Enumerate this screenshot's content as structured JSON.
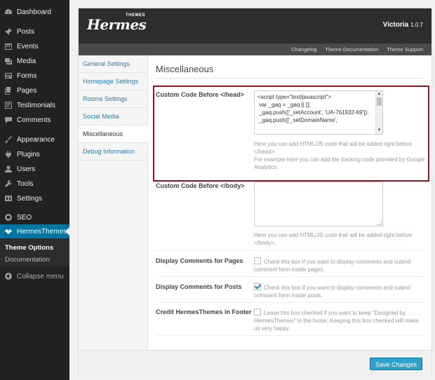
{
  "sidebar": {
    "items": [
      {
        "label": "Dashboard",
        "icon": "dashboard-icon"
      },
      {
        "label": "Posts",
        "icon": "pin-icon"
      },
      {
        "label": "Events",
        "icon": "calendar-icon"
      },
      {
        "label": "Media",
        "icon": "media-icon"
      },
      {
        "label": "Forms",
        "icon": "forms-icon"
      },
      {
        "label": "Pages",
        "icon": "pages-icon"
      },
      {
        "label": "Testimonials",
        "icon": "testimonials-icon"
      },
      {
        "label": "Comments",
        "icon": "comments-icon"
      },
      {
        "label": "Appearance",
        "icon": "brush-icon"
      },
      {
        "label": "Plugins",
        "icon": "plugin-icon"
      },
      {
        "label": "Users",
        "icon": "users-icon"
      },
      {
        "label": "Tools",
        "icon": "wrench-icon"
      },
      {
        "label": "Settings",
        "icon": "settings-icon"
      },
      {
        "label": "SEO",
        "icon": "seo-icon"
      },
      {
        "label": "HermesThemes",
        "icon": "hermes-icon",
        "active": true
      }
    ],
    "submenu": [
      "Theme Options",
      "Documentation"
    ],
    "collapse": "Collapse menu"
  },
  "header": {
    "logo_text": "Hermes",
    "logo_super": "THEMES",
    "theme_name": "Victoria",
    "theme_version": "1.0.7",
    "nav": [
      "Changelog",
      "Theme Documentation",
      "Theme Support"
    ]
  },
  "tabs": [
    {
      "label": "General Settings"
    },
    {
      "label": "Homepage Settings"
    },
    {
      "label": "Rooms Settings"
    },
    {
      "label": "Social Media"
    },
    {
      "label": "Miscellaneous",
      "active": true
    },
    {
      "label": "Debug Information"
    }
  ],
  "section": {
    "title": "Miscellaneous",
    "head_label": "Custom Code Before </head>",
    "head_code": [
      "<script type=\"text/javascript\">",
      "",
      " var _gaq = _gaq || [];",
      " _gaq.push(['_setAccount', 'UA-761932-69']);",
      " _gaq.push(['_setDomainName',"
    ],
    "head_help_1": "Here you can add HTML/JS code that will be added right before </head>.",
    "head_help_2": "For example here you can add the tracking code provided by Google Analytics.",
    "body_label": "Custom Code Before </body>",
    "body_help": "Here you can add HTML/JS code that will be added right before </body>.",
    "comments_pages_label": "Display Comments for Pages",
    "comments_pages_text": "Check this box if you want to display comments and submit comment form inside pages.",
    "comments_pages_checked": false,
    "comments_posts_label": "Display Comments for Posts",
    "comments_posts_text": "Check this box if you want to display comments and submit comment form inside posts.",
    "comments_posts_checked": true,
    "credit_label": "Credit HermesThemes in Footer",
    "credit_text": "Leave this box checked if you want to keep \"Designed by HermesThemes\" in the footer. Keeping this box checked will make us very happy.",
    "credit_checked": false
  },
  "save_label": "Save Changes",
  "colors": {
    "sidebar_bg": "#222222",
    "active_menu": "#0074a2",
    "header_bg": "#2d2d2d",
    "highlight": "#8b1520",
    "link": "#2a7bb0",
    "primary_button": "#2ea2cc"
  }
}
